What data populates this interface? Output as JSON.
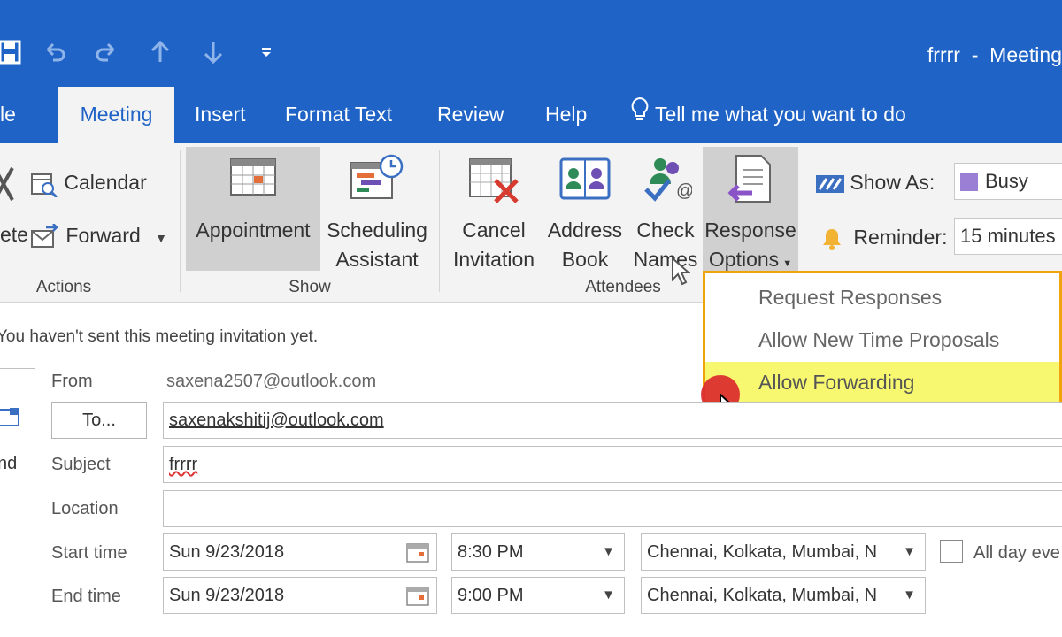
{
  "window": {
    "title": "frrrr  -  Meeting"
  },
  "quick_access": [
    "save-icon",
    "undo-icon",
    "redo-icon",
    "up-arrow-icon",
    "down-arrow-icon",
    "customize-icon"
  ],
  "tabs": [
    {
      "label": "le",
      "active": false
    },
    {
      "label": "Meeting",
      "active": true
    },
    {
      "label": "Insert",
      "active": false
    },
    {
      "label": "Format Text",
      "active": false
    },
    {
      "label": "Review",
      "active": false
    },
    {
      "label": "Help",
      "active": false
    }
  ],
  "tell_me": "Tell me what you want to do",
  "ribbon": {
    "actions": {
      "delete_label": "ete",
      "calendar_label": "Calendar",
      "forward_label": "Forward",
      "group_label": "Actions"
    },
    "show": {
      "appointment_label": "Appointment",
      "scheduling_label_1": "Scheduling",
      "scheduling_label_2": "Assistant",
      "group_label": "Show"
    },
    "attendees": {
      "cancel_label_1": "Cancel",
      "cancel_label_2": "Invitation",
      "address_label_1": "Address",
      "address_label_2": "Book",
      "check_label_1": "Check",
      "check_label_2": "Names",
      "response_label_1": "Response",
      "response_label_2": "Options",
      "group_label": "Attendees"
    },
    "options": {
      "show_as_label": "Show As:",
      "show_as_value": "Busy",
      "reminder_label": "Reminder:",
      "reminder_value": "15 minutes"
    }
  },
  "response_menu": {
    "items": [
      "Request Responses",
      "Allow New Time Proposals",
      "Allow Forwarding"
    ],
    "highlighted": "Allow Forwarding"
  },
  "info_bar": "You haven't sent this meeting invitation yet.",
  "form": {
    "send_label": "nd",
    "from_label": "From",
    "from_value": "saxena2507@outlook.com",
    "to_button": "To...",
    "to_value": "saxenakshitij@outlook.com",
    "subject_label": "Subject",
    "subject_value": "frrrr",
    "location_label": "Location",
    "location_value": "",
    "start_label": "Start time",
    "start_date": "Sun 9/23/2018",
    "start_time": "8:30 PM",
    "start_tz": "Chennai, Kolkata, Mumbai, N",
    "end_label": "End time",
    "end_date": "Sun 9/23/2018",
    "end_time": "9:00 PM",
    "end_tz": "Chennai, Kolkata, Mumbai, N",
    "all_day_label": "All day eve",
    "all_day_checked": false
  },
  "colors": {
    "brand": "#1f63c6",
    "ribbon_bg": "#f3f3f3",
    "menu_border": "#f0a30a",
    "menu_highlight": "#f8f870",
    "busy": "#9b7fd4"
  }
}
